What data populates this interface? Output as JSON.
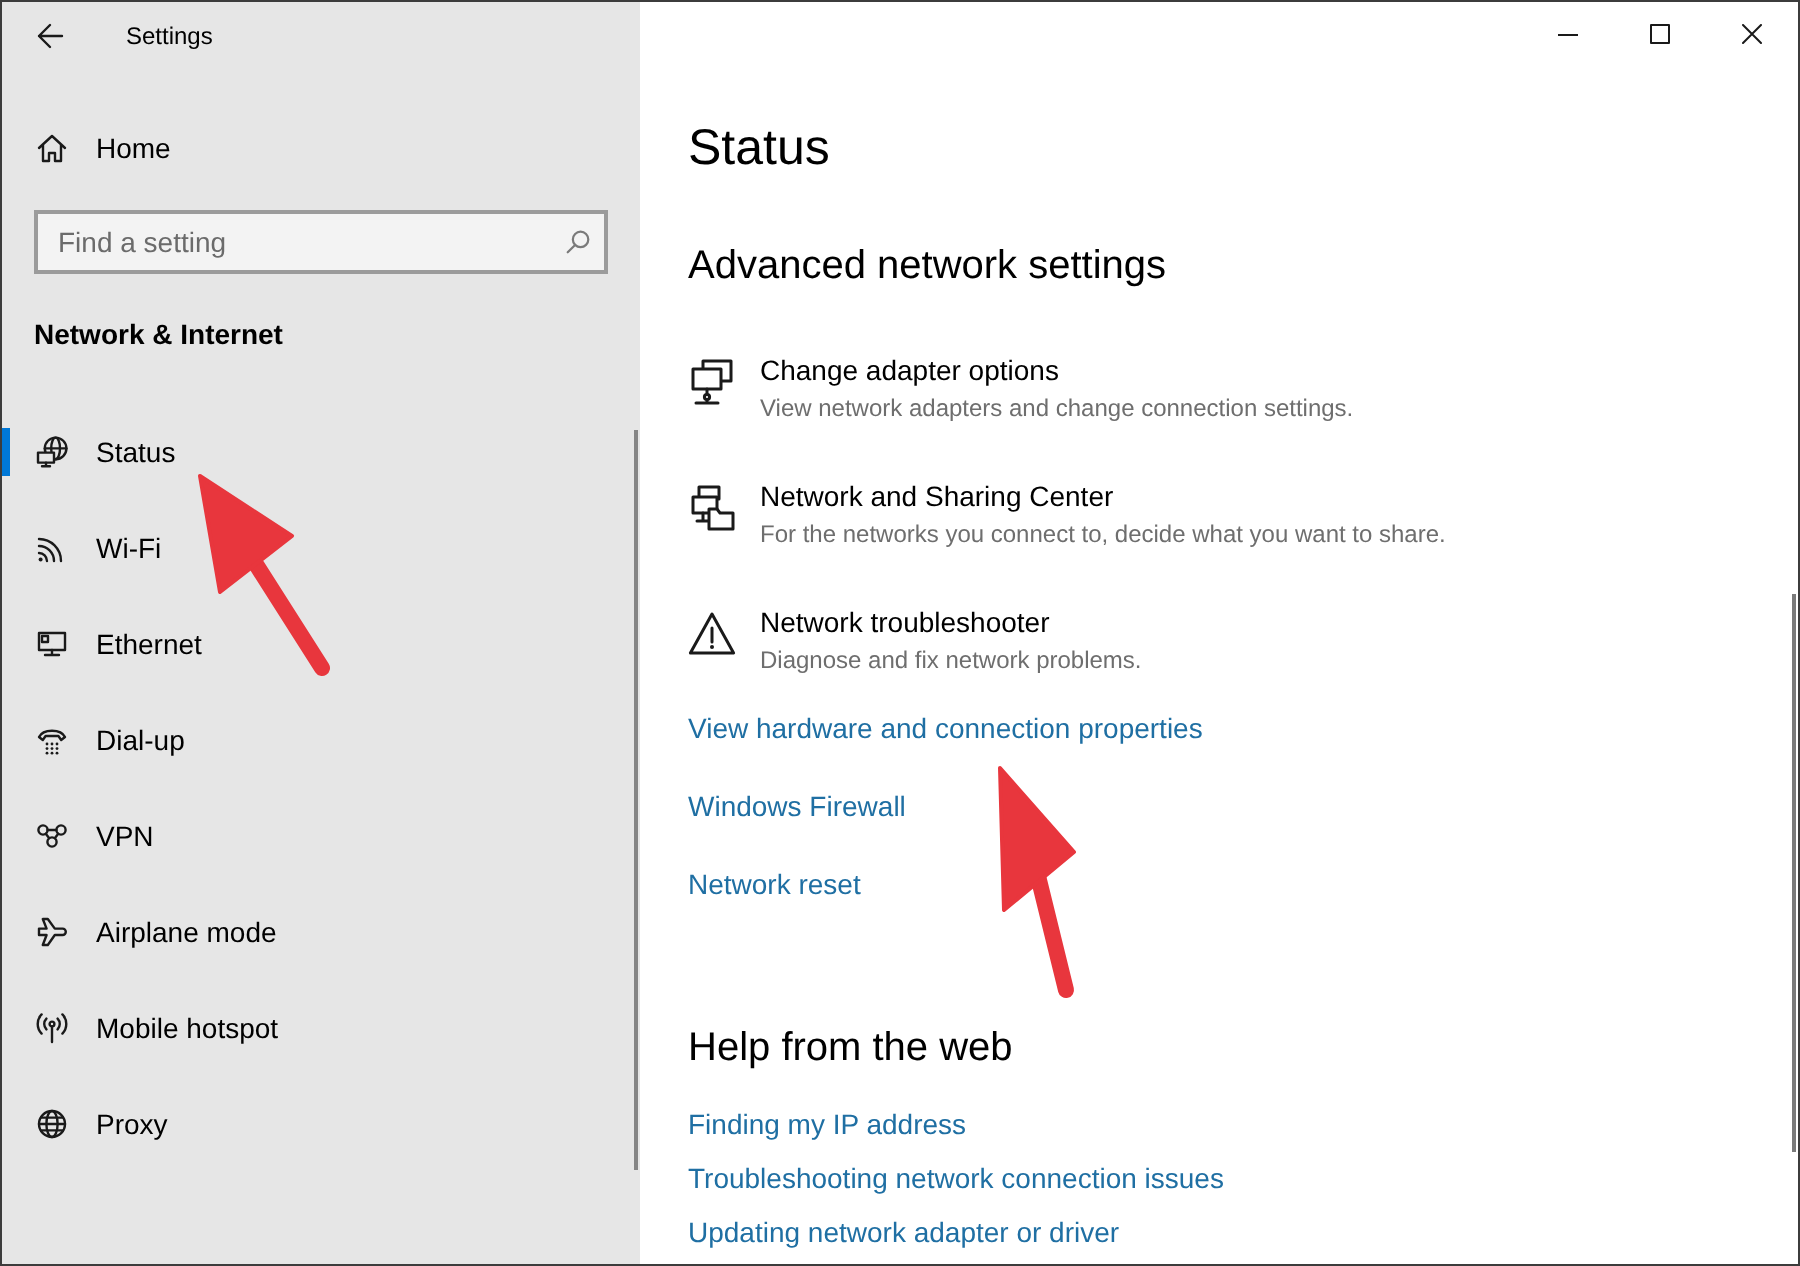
{
  "window": {
    "title": "Settings"
  },
  "sidebar": {
    "home": "Home",
    "search": {
      "placeholder": "Find a setting"
    },
    "section_title": "Network & Internet",
    "items": [
      {
        "kind": "status",
        "label": "Status",
        "selected": true
      },
      {
        "kind": "wifi",
        "label": "Wi-Fi",
        "selected": false
      },
      {
        "kind": "ethernet",
        "label": "Ethernet",
        "selected": false
      },
      {
        "kind": "dialup",
        "label": "Dial-up",
        "selected": false
      },
      {
        "kind": "vpn",
        "label": "VPN",
        "selected": false
      },
      {
        "kind": "airplane",
        "label": "Airplane mode",
        "selected": false
      },
      {
        "kind": "hotspot",
        "label": "Mobile hotspot",
        "selected": false
      },
      {
        "kind": "proxy",
        "label": "Proxy",
        "selected": false
      }
    ]
  },
  "content": {
    "title": "Status",
    "sections": [
      {
        "kind": "settings",
        "heading": "Advanced network settings",
        "items": [
          {
            "kind": "adapter",
            "title": "Change adapter options",
            "description": "View network adapters and change connection settings."
          },
          {
            "kind": "sharing",
            "title": "Network and Sharing Center",
            "description": "For the networks you connect to, decide what you want to share."
          },
          {
            "kind": "troubleshooter",
            "title": "Network troubleshooter",
            "description": "Diagnose and fix network problems."
          }
        ],
        "links": [
          "View hardware and connection properties",
          "Windows Firewall",
          "Network reset"
        ]
      },
      {
        "kind": "help",
        "heading": "Help from the web",
        "links": [
          "Finding my IP address",
          "Troubleshooting network connection issues",
          "Updating network adapter or driver"
        ]
      }
    ]
  }
}
